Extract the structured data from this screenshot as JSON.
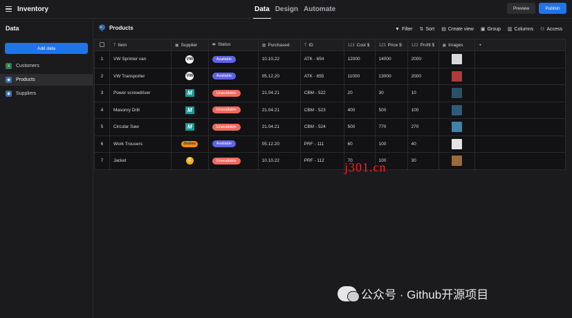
{
  "app": {
    "title": "Inventory",
    "tabs": [
      {
        "label": "Data",
        "active": true
      },
      {
        "label": "Design",
        "active": false
      },
      {
        "label": "Automate",
        "active": false
      }
    ],
    "preview_label": "Preview",
    "publish_label": "Publish"
  },
  "sidebar": {
    "title": "Data",
    "add_data_label": "Add data",
    "items": [
      {
        "label": "Customers",
        "icon": "sheet-icon",
        "color": "#2f7a4f"
      },
      {
        "label": "Products",
        "icon": "postgres-icon",
        "color": "#3a6fa8",
        "active": true
      },
      {
        "label": "Suppliers",
        "icon": "postgres-icon",
        "color": "#3a6fa8"
      }
    ]
  },
  "main": {
    "title": "Products",
    "toolbar": {
      "filter": "Filter",
      "sort": "Sort",
      "create_view": "Create view",
      "group": "Group",
      "columns": "Columns",
      "access": "Access"
    },
    "columns": [
      "Item",
      "Supplier",
      "Status",
      "Purchased",
      "ID",
      "Cost $",
      "Price $",
      "Profit $",
      "Images"
    ],
    "add_column": "+",
    "rows": [
      {
        "n": "1",
        "item": "VW Sprinter van",
        "supplier": "VW",
        "status": "Available",
        "purchased": "10.10.22",
        "id": "ATK - 654",
        "cost": "12000",
        "price": "14000",
        "profit": "2000",
        "image_color": "#d9d9d9"
      },
      {
        "n": "2",
        "item": "VW Transporter",
        "supplier": "VW",
        "status": "Available",
        "purchased": "05.12.20",
        "id": "ATK - 655",
        "cost": "11000",
        "price": "13000",
        "profit": "2000",
        "image_color": "#b03a3a"
      },
      {
        "n": "3",
        "item": "Power screwdriver",
        "supplier": "M",
        "status": "Unavailable",
        "purchased": "21.04.21",
        "id": "CBM - 522",
        "cost": "20",
        "price": "30",
        "profit": "10",
        "image_color": "#2b4f66"
      },
      {
        "n": "4",
        "item": "Masonry Drill",
        "supplier": "M",
        "status": "Unavailable",
        "purchased": "21.04.21",
        "id": "CBM - 523",
        "cost": "400",
        "price": "500",
        "profit": "100",
        "image_color": "#2d5b7a"
      },
      {
        "n": "5",
        "item": "Circular Saw",
        "supplier": "M",
        "status": "Unavailable",
        "purchased": "21.04.21",
        "id": "CBM - 524",
        "cost": "500",
        "price": "770",
        "profit": "270",
        "image_color": "#3d84a8"
      },
      {
        "n": "6",
        "item": "Work Trousers",
        "supplier": "Dickies",
        "status": "Available",
        "purchased": "05.12.20",
        "id": "PRF - 111",
        "cost": "60",
        "price": "100",
        "profit": "40",
        "image_color": "#e4e4e4"
      },
      {
        "n": "7",
        "item": "Jacket",
        "supplier": "C",
        "status": "Unavailable",
        "purchased": "10.10.22",
        "id": "PRF - 112",
        "cost": "70",
        "price": "100",
        "profit": "30",
        "image_color": "#9a6a3a"
      }
    ]
  },
  "overlays": {
    "watermark": "j301.cn",
    "wechat": "公众号 · Github开源项目"
  }
}
